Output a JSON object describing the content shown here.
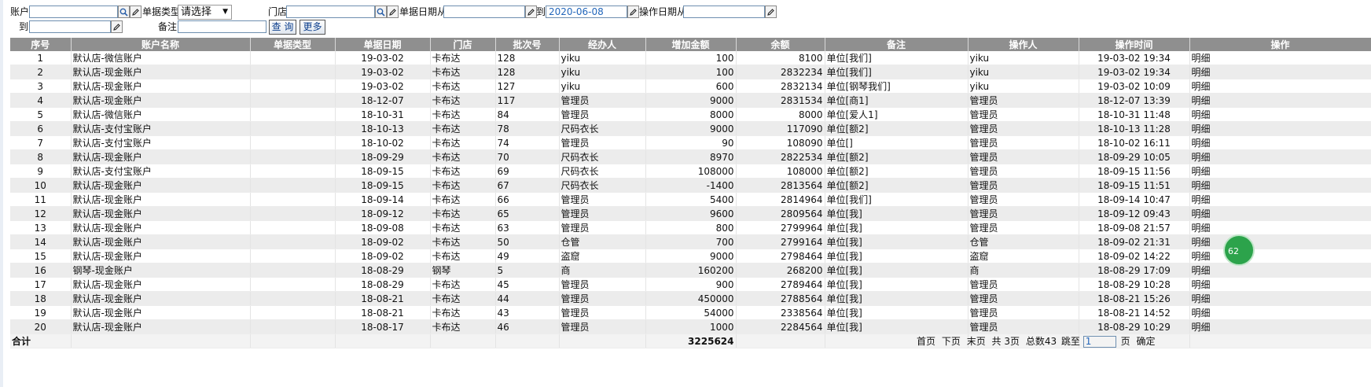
{
  "filters": {
    "account_label": "账户",
    "account_value": "",
    "doc_type_label": "单据类型",
    "doc_type_value": "请选择",
    "store_label": "门店",
    "store_value": "",
    "doc_date_from_label": "单据日期从",
    "doc_date_from_value": "",
    "to_label": "到",
    "doc_date_to_value": "2020-06-08",
    "op_date_from_label": "操作日期从",
    "op_date_from_value": "",
    "op_date_to_label": "到",
    "op_date_to_value": "",
    "remark_label": "备注",
    "remark_value": "",
    "query_button": "查 询",
    "more_button": "更多"
  },
  "table": {
    "headers": [
      "序号",
      "账户名称",
      "单据类型",
      "单据日期",
      "门店",
      "批次号",
      "经办人",
      "增加金额",
      "余额",
      "备注",
      "操作人",
      "操作时间",
      "操作"
    ],
    "rows": [
      [
        "1",
        "默认店-微信账户",
        "",
        "19-03-02",
        "卡布达",
        "128",
        "yiku",
        "100",
        "8100",
        "单位[我们]",
        "yiku",
        "19-03-02 19:34",
        "明细"
      ],
      [
        "2",
        "默认店-现金账户",
        "",
        "19-03-02",
        "卡布达",
        "128",
        "yiku",
        "100",
        "2832234",
        "单位[我们]",
        "yiku",
        "19-03-02 19:34",
        "明细"
      ],
      [
        "3",
        "默认店-现金账户",
        "",
        "19-03-02",
        "卡布达",
        "127",
        "yiku",
        "600",
        "2832134",
        "单位[钢琴我们]",
        "yiku",
        "19-03-02 10:09",
        "明细"
      ],
      [
        "4",
        "默认店-现金账户",
        "",
        "18-12-07",
        "卡布达",
        "117",
        "管理员",
        "9000",
        "2831534",
        "单位[商1]",
        "管理员",
        "18-12-07 13:39",
        "明细"
      ],
      [
        "5",
        "默认店-微信账户",
        "",
        "18-10-31",
        "卡布达",
        "84",
        "管理员",
        "8000",
        "8000",
        "单位[爱人1]",
        "管理员",
        "18-10-31 11:48",
        "明细"
      ],
      [
        "6",
        "默认店-支付宝账户",
        "",
        "18-10-13",
        "卡布达",
        "78",
        "尺码衣长",
        "9000",
        "117090",
        "单位[额2]",
        "管理员",
        "18-10-13 11:28",
        "明细"
      ],
      [
        "7",
        "默认店-支付宝账户",
        "",
        "18-10-02",
        "卡布达",
        "74",
        "管理员",
        "90",
        "108090",
        "单位[]",
        "管理员",
        "18-10-02 16:11",
        "明细"
      ],
      [
        "8",
        "默认店-现金账户",
        "",
        "18-09-29",
        "卡布达",
        "70",
        "尺码衣长",
        "8970",
        "2822534",
        "单位[额2]",
        "管理员",
        "18-09-29 10:05",
        "明细"
      ],
      [
        "9",
        "默认店-支付宝账户",
        "",
        "18-09-15",
        "卡布达",
        "69",
        "尺码衣长",
        "108000",
        "108000",
        "单位[额2]",
        "管理员",
        "18-09-15 11:56",
        "明细"
      ],
      [
        "10",
        "默认店-现金账户",
        "",
        "18-09-15",
        "卡布达",
        "67",
        "尺码衣长",
        "-1400",
        "2813564",
        "单位[额2]",
        "管理员",
        "18-09-15 11:51",
        "明细"
      ],
      [
        "11",
        "默认店-现金账户",
        "",
        "18-09-14",
        "卡布达",
        "66",
        "管理员",
        "5400",
        "2814964",
        "单位[我们]",
        "管理员",
        "18-09-14 10:47",
        "明细"
      ],
      [
        "12",
        "默认店-现金账户",
        "",
        "18-09-12",
        "卡布达",
        "65",
        "管理员",
        "9600",
        "2809564",
        "单位[我]",
        "管理员",
        "18-09-12 09:43",
        "明细"
      ],
      [
        "13",
        "默认店-现金账户",
        "",
        "18-09-08",
        "卡布达",
        "63",
        "管理员",
        "800",
        "2799964",
        "单位[我]",
        "管理员",
        "18-09-08 21:57",
        "明细"
      ],
      [
        "14",
        "默认店-现金账户",
        "",
        "18-09-02",
        "卡布达",
        "50",
        "仓管",
        "700",
        "2799164",
        "单位[我]",
        "仓管",
        "18-09-02 21:31",
        "明细"
      ],
      [
        "15",
        "默认店-现金账户",
        "",
        "18-09-02",
        "卡布达",
        "49",
        "盗窟",
        "9000",
        "2798464",
        "单位[我]",
        "盗窟",
        "18-09-02 14:22",
        "明细"
      ],
      [
        "16",
        "钢琴-现金账户",
        "",
        "18-08-29",
        "钢琴",
        "5",
        "商",
        "160200",
        "268200",
        "单位[我]",
        "商",
        "18-08-29 17:09",
        "明细"
      ],
      [
        "17",
        "默认店-现金账户",
        "",
        "18-08-29",
        "卡布达",
        "45",
        "管理员",
        "900",
        "2789464",
        "单位[我]",
        "管理员",
        "18-08-29 10:28",
        "明细"
      ],
      [
        "18",
        "默认店-现金账户",
        "",
        "18-08-21",
        "卡布达",
        "44",
        "管理员",
        "450000",
        "2788564",
        "单位[我]",
        "管理员",
        "18-08-21 15:26",
        "明细"
      ],
      [
        "19",
        "默认店-现金账户",
        "",
        "18-08-21",
        "卡布达",
        "43",
        "管理员",
        "54000",
        "2338564",
        "单位[我]",
        "管理员",
        "18-08-21 14:52",
        "明细"
      ],
      [
        "20",
        "默认店-现金账户",
        "",
        "18-08-17",
        "卡布达",
        "46",
        "管理员",
        "1000",
        "2284564",
        "单位[我]",
        "管理员",
        "18-08-29 10:29",
        "明细"
      ]
    ],
    "total_label": "合计",
    "total_amount": "3225624"
  },
  "pager": {
    "first": "首页",
    "next": "下页",
    "last": "末页",
    "pages_text": "共 3页",
    "total_text": "总数43",
    "jump_label": "跳至",
    "jump_value": "1",
    "page_suffix": "页",
    "confirm": "确定"
  },
  "floating_badge_text": "62",
  "icons": {
    "search_icon": "magnifier-icon",
    "edit_icon": "pencil-icon",
    "dropdown_icon": "triangle-down-icon"
  }
}
